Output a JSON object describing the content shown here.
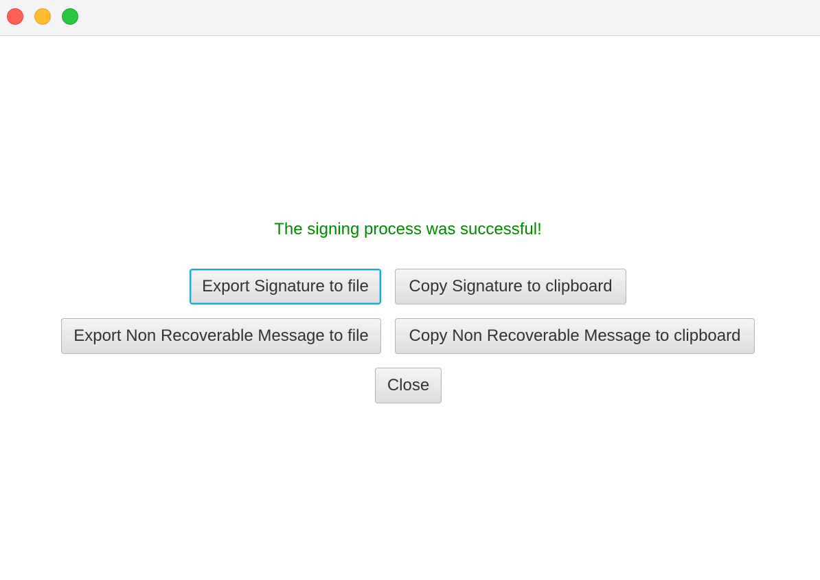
{
  "window": {
    "controls": {
      "close_color": "#fe5f57",
      "minimize_color": "#febc2e",
      "maximize_color": "#28c840"
    }
  },
  "dialog": {
    "status_message": "The signing process was successful!",
    "status_color": "#008a00",
    "buttons": {
      "export_signature": "Export Signature to file",
      "copy_signature": "Copy Signature to clipboard",
      "export_message": "Export Non Recoverable Message to file",
      "copy_message": "Copy Non Recoverable Message to clipboard",
      "close": "Close"
    },
    "focused_button": "export_signature",
    "focus_color": "#19a9d4"
  }
}
